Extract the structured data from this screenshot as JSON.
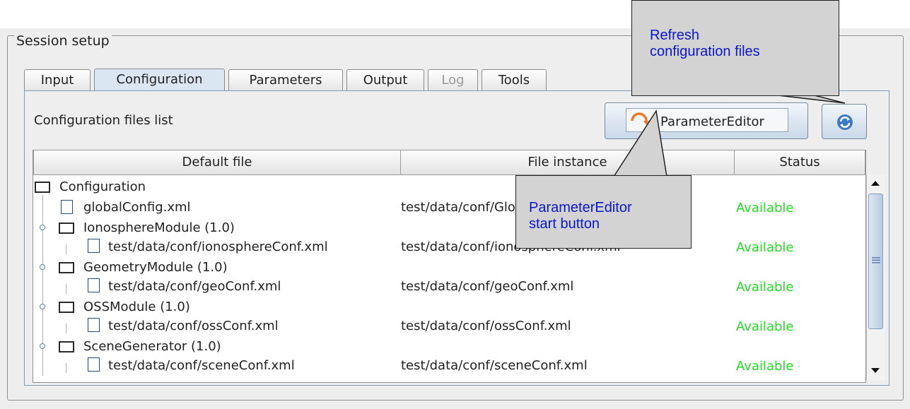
{
  "session": {
    "title": "Session setup"
  },
  "tabs": [
    {
      "label": "Input",
      "active": false,
      "disabled": false
    },
    {
      "label": "Configuration",
      "active": true,
      "disabled": false
    },
    {
      "label": "Parameters",
      "active": false,
      "disabled": false
    },
    {
      "label": "Output",
      "active": false,
      "disabled": false
    },
    {
      "label": "Log",
      "active": false,
      "disabled": true
    },
    {
      "label": "Tools",
      "active": false,
      "disabled": false
    }
  ],
  "config_panel": {
    "files_label": "Configuration files list",
    "param_editor_button": "ParameterEditor",
    "refresh_icon": "refresh-icon"
  },
  "table": {
    "columns": [
      "Default file",
      "File instance",
      "Status"
    ],
    "rows": [
      {
        "default": "Configuration",
        "instance": "",
        "status": ""
      },
      {
        "default": "globalConfig.xml",
        "instance": "test/data/conf/GlobalConfiguration.xml",
        "status": "Available"
      },
      {
        "default": "IonosphereModule (1.0)",
        "instance": "",
        "status": ""
      },
      {
        "default": "test/data/conf/ionosphereConf.xml",
        "instance": "test/data/conf/ionosphereConf.xml",
        "status": "Available"
      },
      {
        "default": "GeometryModule (1.0)",
        "instance": "",
        "status": ""
      },
      {
        "default": "test/data/conf/geoConf.xml",
        "instance": "test/data/conf/geoConf.xml",
        "status": "Available"
      },
      {
        "default": "OSSModule (1.0)",
        "instance": "",
        "status": ""
      },
      {
        "default": "test/data/conf/ossConf.xml",
        "instance": "test/data/conf/ossConf.xml",
        "status": "Available"
      },
      {
        "default": "SceneGenerator (1.0)",
        "instance": "",
        "status": ""
      },
      {
        "default": "test/data/conf/sceneConf.xml",
        "instance": "test/data/conf/sceneConf.xml",
        "status": "Available"
      }
    ]
  },
  "callouts": {
    "refresh": {
      "line1": "Refresh",
      "line2": "configuration files"
    },
    "param_editor": {
      "line1": "ParameterEditor",
      "line2": "start button"
    }
  },
  "colors": {
    "available": "#22dd22",
    "callout_text": "#0b17cc",
    "active_tab": "#dbe6f3"
  }
}
